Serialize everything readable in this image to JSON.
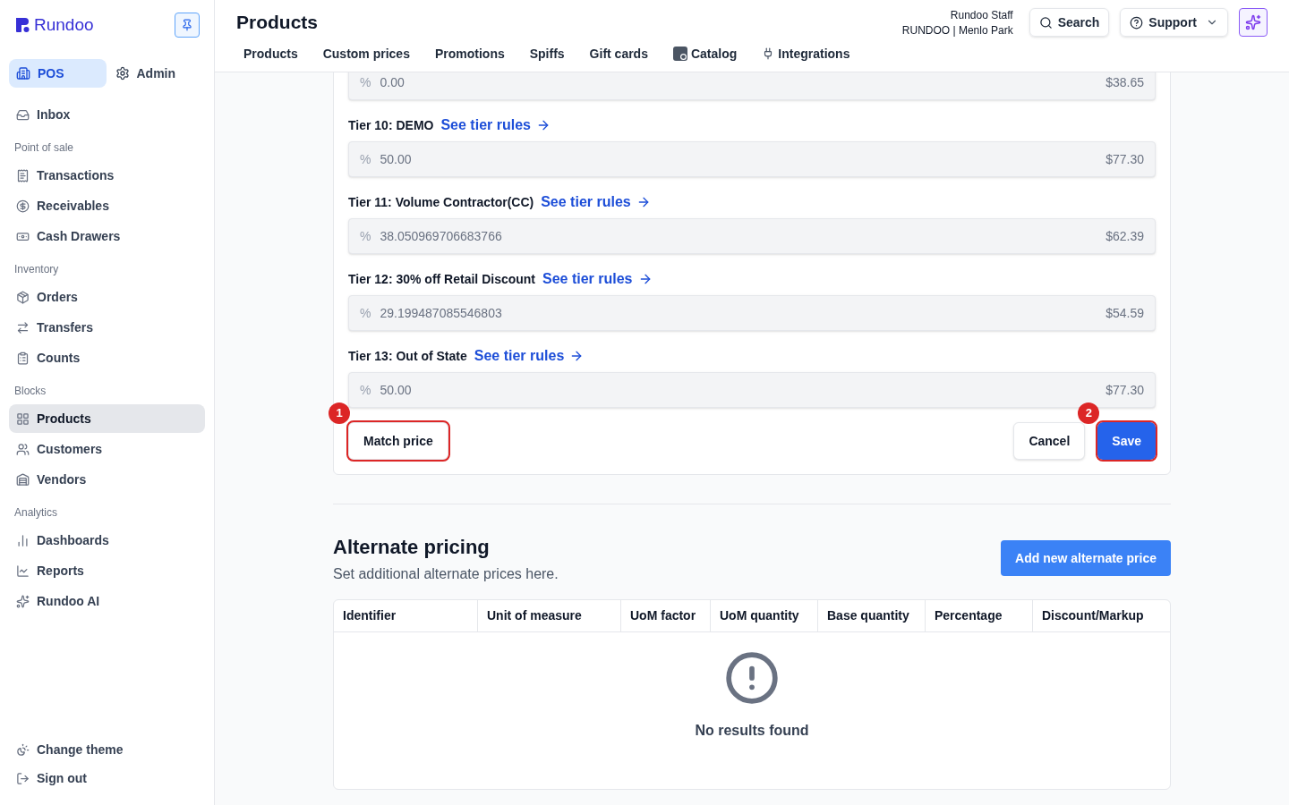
{
  "sidebar": {
    "brand": "Rundoo",
    "modes": [
      {
        "label": "POS",
        "selected": true
      },
      {
        "label": "Admin",
        "selected": false
      }
    ],
    "sections": [
      {
        "items": [
          {
            "label": "Inbox",
            "selected": false
          }
        ]
      },
      {
        "title": "Point of sale",
        "items": [
          {
            "label": "Transactions",
            "selected": false
          },
          {
            "label": "Receivables",
            "selected": false
          },
          {
            "label": "Cash Drawers",
            "selected": false
          }
        ]
      },
      {
        "title": "Inventory",
        "items": [
          {
            "label": "Orders",
            "selected": false
          },
          {
            "label": "Transfers",
            "selected": false
          },
          {
            "label": "Counts",
            "selected": false
          }
        ]
      },
      {
        "title": "Blocks",
        "items": [
          {
            "label": "Products",
            "selected": true
          },
          {
            "label": "Customers",
            "selected": false
          },
          {
            "label": "Vendors",
            "selected": false
          }
        ]
      },
      {
        "title": "Analytics",
        "items": [
          {
            "label": "Dashboards",
            "selected": false
          },
          {
            "label": "Reports",
            "selected": false
          },
          {
            "label": "Rundoo AI",
            "selected": false
          }
        ]
      }
    ],
    "footer": [
      "Change theme",
      "Sign out"
    ]
  },
  "header": {
    "title": "Products",
    "user": "Rundoo Staff",
    "store": "RUNDOO | Menlo Park",
    "search": "Search",
    "support": "Support",
    "tabs": [
      "Products",
      "Custom prices",
      "Promotions",
      "Spiffs",
      "Gift cards",
      "Catalog",
      "Integrations"
    ]
  },
  "tiers": [
    {
      "unit": "%",
      "value": "0.00",
      "price": "$38.65"
    },
    {
      "label": "Tier 10: DEMO",
      "link": "See tier rules",
      "unit": "%",
      "value": "50.00",
      "price": "$77.30"
    },
    {
      "label": "Tier 11: Volume Contractor(CC)",
      "link": "See tier rules",
      "unit": "%",
      "value": "38.050969706683766",
      "price": "$62.39"
    },
    {
      "label": "Tier 12: 30% off Retail Discount",
      "link": "See tier rules",
      "unit": "%",
      "value": "29.199487085546803",
      "price": "$54.59"
    },
    {
      "label": "Tier 13: Out of State",
      "link": "See tier rules",
      "unit": "%",
      "value": "50.00",
      "price": "$77.30"
    }
  ],
  "actions": [
    {
      "label": "Match price",
      "kind": "secondary",
      "marker": "1"
    },
    {
      "label": "Cancel",
      "kind": "secondary"
    },
    {
      "label": "Save",
      "kind": "primary",
      "marker": "2"
    }
  ],
  "alternate_pricing": {
    "title": "Alternate pricing",
    "subtitle": "Set additional alternate prices here.",
    "add_button": "Add new alternate price",
    "columns": [
      "Identifier",
      "Unit of measure",
      "UoM factor",
      "UoM quantity",
      "Base quantity",
      "Percentage",
      "Discount/Markup"
    ],
    "empty": "No results found"
  }
}
